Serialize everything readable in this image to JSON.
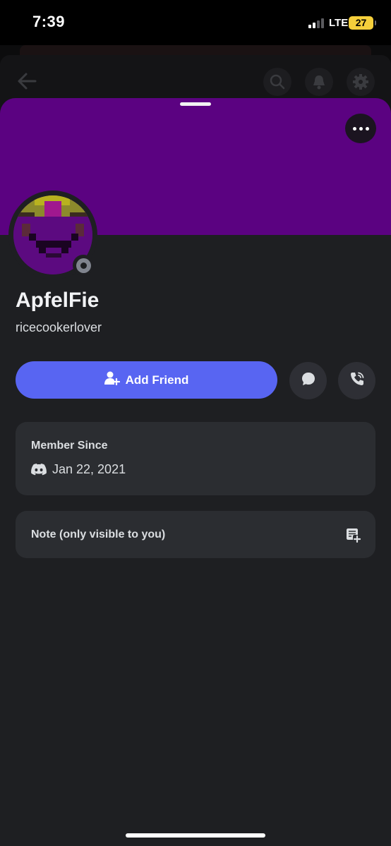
{
  "status_bar": {
    "time": "7:39",
    "network": "LTE",
    "battery": "27",
    "signal_bars": 4,
    "signal_bars_active": 2
  },
  "background_nav": {
    "icons": [
      "back-arrow-icon",
      "search-icon",
      "bell-icon",
      "gear-icon"
    ]
  },
  "profile": {
    "banner_color": "#5b0281",
    "display_name": "ApfelFie",
    "username": "ricecookerlover",
    "presence": "offline",
    "presence_color": "#80848e"
  },
  "actions": {
    "add_friend_label": "Add Friend",
    "add_friend_color": "#5865f2",
    "message_icon": "chat-bubble-icon",
    "call_icon": "phone-call-icon"
  },
  "member_since": {
    "title": "Member Since",
    "date": "Jan 22, 2021",
    "icon": "discord-logo-icon"
  },
  "note": {
    "label": "Note (only visible to you)",
    "icon": "add-note-icon"
  }
}
